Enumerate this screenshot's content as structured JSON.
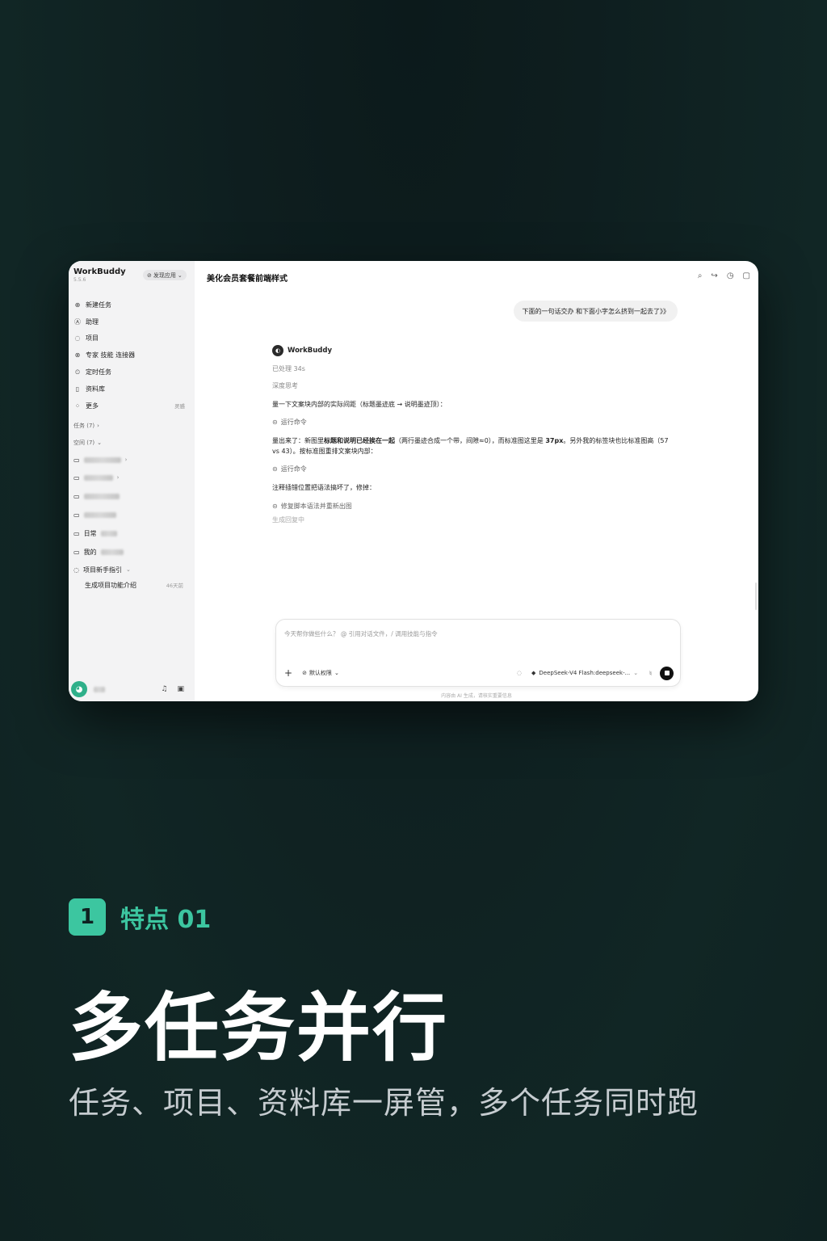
{
  "app": {
    "name": "WorkBuddy",
    "version": "5.5.6",
    "discover_label": "发现应用"
  },
  "sidebar": {
    "nav": [
      {
        "icon": "plus-circle-icon",
        "glyph": "⊕",
        "label": "新建任务"
      },
      {
        "icon": "assistant-icon",
        "glyph": "Ⓐ",
        "label": "助理"
      },
      {
        "icon": "project-icon",
        "glyph": "◌",
        "label": "项目"
      },
      {
        "icon": "experts-icon",
        "glyph": "⊗",
        "label": "专家 技能 连接器"
      },
      {
        "icon": "timer-icon",
        "glyph": "⏲",
        "label": "定时任务"
      },
      {
        "icon": "library-icon",
        "glyph": "▯",
        "label": "资料库"
      },
      {
        "icon": "more-icon",
        "glyph": "⁘",
        "label": "更多",
        "right": "灵感"
      }
    ],
    "tasks_section": "任务 (7)",
    "spaces_section": "空间 (7)",
    "spaces": [
      {
        "label": ""
      },
      {
        "label": ""
      },
      {
        "label": ""
      },
      {
        "label": ""
      },
      {
        "label": "日常"
      },
      {
        "label": "我的"
      }
    ],
    "project_group": "项目新手指引",
    "project_task": {
      "label": "生成项目功能介绍",
      "age": "46天前"
    }
  },
  "chat": {
    "title": "美化会员套餐前端样式",
    "user_message": "下面的一句话交办 和下面小字怎么挤到一起去了》》",
    "bot_name": "WorkBuddy",
    "processed": "已处理 34s",
    "thinking": "深度思考",
    "p1": "量一下文案块内部的实际间距（标题墨迹底 → 说明墨迹顶）：",
    "step1": "运行命令",
    "p2_a": "量出来了：新图里",
    "p2_b": "标题和说明已经挨在一起",
    "p2_c": "（两行墨迹合成一个带，间隙≈0），而标准图这里是 ",
    "p2_d": "37px",
    "p2_e": "。另外我的标签块也比标准图高（57 vs 43）。按标准图重排文案块内部：",
    "step2": "运行命令",
    "p3": "注释插错位置把语法搞坏了，修掉：",
    "step3": "修复脚本语法并重新出图",
    "generating": "生成回复中"
  },
  "input": {
    "placeholder": "今天帮你做些什么？ @ 引用对话文件，/ 调用技能与指令",
    "permission": "默认权限",
    "model": "DeepSeek-V4 Flash:deepseek-...",
    "disclaimer": "内容由 AI 生成，请核实重要信息"
  },
  "feature": {
    "badge": "1",
    "tag": "特点 01",
    "headline": "多任务并行",
    "subhead": "任务、项目、资料库一屏管，多个任务同时跑"
  },
  "colors": {
    "accent": "#3cc6a0",
    "background": "#0f2221"
  }
}
